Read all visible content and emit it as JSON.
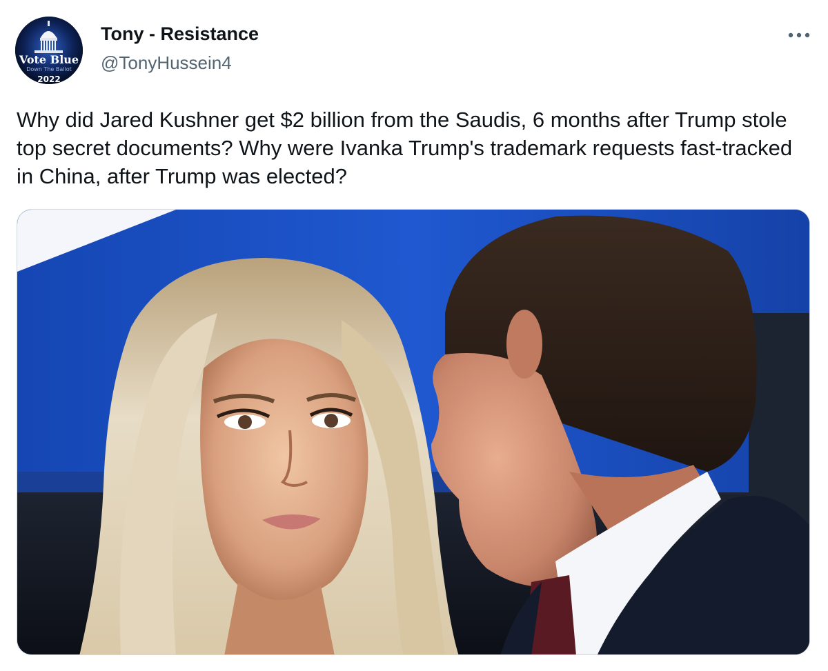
{
  "post": {
    "author_name": "Tony - Resistance",
    "author_handle": "@TonyHussein4",
    "text": "Why did Jared Kushner get $2 billion from the Saudis, 6 months after Trump stole top secret documents? Why were Ivanka Trump's trademark requests fast-tracked in China, after Trump was elected?",
    "more_icon": "more-horizontal-icon"
  },
  "avatar": {
    "line1": "Vote Blue",
    "line2": "Down The Ballot",
    "year": "2022"
  },
  "colors": {
    "name": "#0f1419",
    "handle": "#536471",
    "text": "#0f1419",
    "avatar_bg": "#0a1a40",
    "photo_sky": "#1d55c8"
  }
}
